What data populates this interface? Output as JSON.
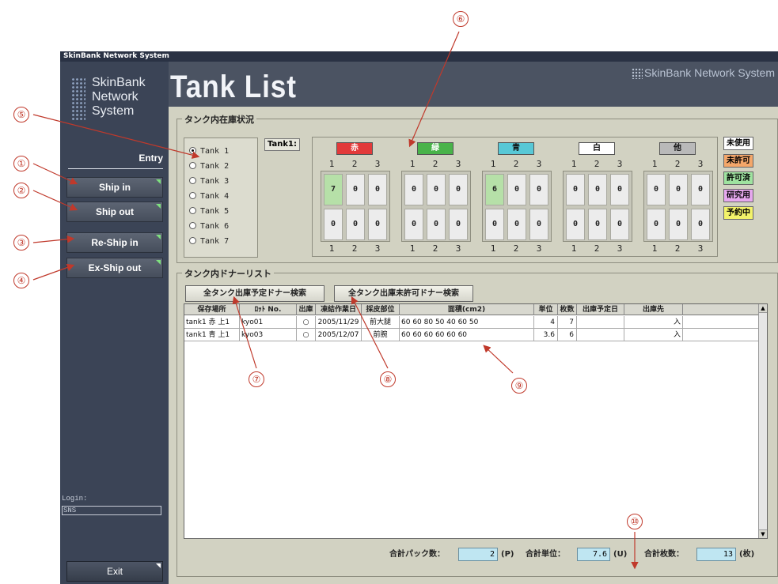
{
  "window": {
    "title": "SkinBank Network System"
  },
  "sidebar": {
    "logo_lines": [
      "SkinBank",
      "Network",
      "System"
    ],
    "entry_label": "Entry",
    "buttons": [
      {
        "label": "Ship in"
      },
      {
        "label": "Ship out"
      },
      {
        "label": "Re-Ship in"
      },
      {
        "label": "Ex-Ship out"
      }
    ],
    "login_label": "Login:",
    "login_value": "SNS",
    "exit_label": "Exit"
  },
  "header": {
    "title": "Tank List",
    "brand": "SkinBank Network System"
  },
  "inventory": {
    "group_title": "タンク内在庫状況",
    "tanks": [
      "Tank 1",
      "Tank 2",
      "Tank 3",
      "Tank 4",
      "Tank 5",
      "Tank 6",
      "Tank 7"
    ],
    "selected_tank": "Tank 1",
    "tank_tag": "Tank1:",
    "colors": [
      {
        "label": "赤",
        "badge_color": "#e23a3a",
        "text_color": "#ffffff",
        "cols": [
          "1",
          "2",
          "3"
        ],
        "rows": [
          [
            "7",
            "0",
            "0"
          ],
          [
            "0",
            "0",
            "0"
          ]
        ],
        "highlight": [
          [
            true,
            false,
            false
          ],
          [
            false,
            false,
            false
          ]
        ]
      },
      {
        "label": "緑",
        "badge_color": "#49b34a",
        "text_color": "#ffffff",
        "cols": [
          "1",
          "2",
          "3"
        ],
        "rows": [
          [
            "0",
            "0",
            "0"
          ],
          [
            "0",
            "0",
            "0"
          ]
        ],
        "highlight": [
          [
            false,
            false,
            false
          ],
          [
            false,
            false,
            false
          ]
        ]
      },
      {
        "label": "青",
        "badge_color": "#58c8d6",
        "text_color": "#111111",
        "cols": [
          "1",
          "2",
          "3"
        ],
        "rows": [
          [
            "6",
            "0",
            "0"
          ],
          [
            "0",
            "0",
            "0"
          ]
        ],
        "highlight": [
          [
            true,
            false,
            false
          ],
          [
            false,
            false,
            false
          ]
        ]
      },
      {
        "label": "白",
        "badge_color": "#ffffff",
        "text_color": "#111111",
        "cols": [
          "1",
          "2",
          "3"
        ],
        "rows": [
          [
            "0",
            "0",
            "0"
          ],
          [
            "0",
            "0",
            "0"
          ]
        ],
        "highlight": [
          [
            false,
            false,
            false
          ],
          [
            false,
            false,
            false
          ]
        ]
      },
      {
        "label": "他",
        "badge_color": "#b9b9b9",
        "text_color": "#111111",
        "cols": [
          "1",
          "2",
          "3"
        ],
        "rows": [
          [
            "0",
            "0",
            "0"
          ],
          [
            "0",
            "0",
            "0"
          ]
        ],
        "highlight": [
          [
            false,
            false,
            false
          ],
          [
            false,
            false,
            false
          ]
        ]
      }
    ],
    "legend": [
      {
        "label": "未使用",
        "color": "#ffffff"
      },
      {
        "label": "未許可",
        "color": "#f4a76a"
      },
      {
        "label": "許可済",
        "color": "#9fe3a0"
      },
      {
        "label": "研究用",
        "color": "#e6a8ee"
      },
      {
        "label": "予約中",
        "color": "#f3f36a"
      }
    ]
  },
  "donor": {
    "group_title": "タンク内ドナーリスト",
    "search_btn_1": "全タンク出庫予定ドナー検索",
    "search_btn_2": "全タンク出庫未許可ドナー検索",
    "columns": [
      "保存場所",
      "ﾛｯﾄ No.",
      "出庫",
      "凍結作業日",
      "採皮部位",
      "面積(cm2)",
      "単位",
      "枚数",
      "出庫予定日",
      "出庫先"
    ],
    "rows": [
      [
        "tank1 赤 上1",
        "kyo01",
        "○",
        "2005/11/29",
        "前大腿",
        "60 60 80 50 40 60 50",
        "4",
        "7",
        "",
        "入"
      ],
      [
        "tank1 青 上1",
        "kyo03",
        "○",
        "2005/12/07",
        "前腕",
        "60 60 60 60 60 60",
        "3.6",
        "6",
        "",
        "入"
      ]
    ]
  },
  "totals": {
    "packs_label": "合計パック数：",
    "packs_value": "2",
    "packs_unit": "(P)",
    "units_label": "合計単位：",
    "units_value": "7.6",
    "units_unit": "(U)",
    "sheets_label": "合計枚数：",
    "sheets_value": "13",
    "sheets_unit": "(枚)"
  },
  "callouts": [
    "①",
    "②",
    "③",
    "④",
    "⑤",
    "⑥",
    "⑦",
    "⑧",
    "⑨",
    "⑩"
  ],
  "accent_color": "#c0392b"
}
